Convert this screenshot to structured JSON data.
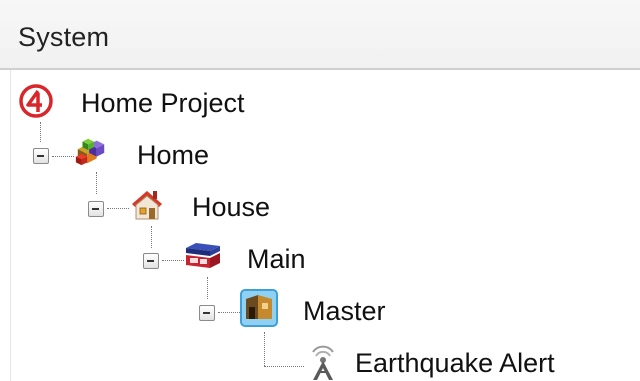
{
  "panel": {
    "header_label": "System"
  },
  "tree": {
    "root": {
      "label": "Home Project",
      "icon": "c4-logo-icon"
    },
    "home": {
      "label": "Home",
      "icon": "home-cubes-icon"
    },
    "house": {
      "label": "House",
      "icon": "house-icon"
    },
    "main": {
      "label": "Main",
      "icon": "floor-icon"
    },
    "master": {
      "label": "Master",
      "icon": "room-icon"
    },
    "earthquake": {
      "label": "Earthquake Alert",
      "icon": "alert-tower-icon"
    }
  }
}
